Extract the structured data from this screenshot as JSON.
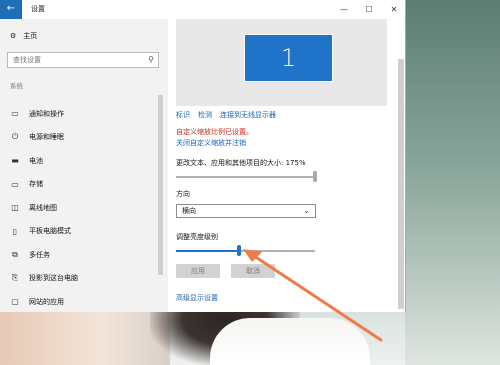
{
  "window": {
    "title": "设置",
    "back": "←",
    "minimize": "—",
    "maximize": "☐",
    "close": "✕"
  },
  "sidebar": {
    "home": "主页",
    "search_placeholder": "查找设置",
    "section": "系统",
    "items": [
      {
        "label": "通知和操作",
        "icon": "notification-icon"
      },
      {
        "label": "电源和睡眠",
        "icon": "power-icon"
      },
      {
        "label": "电池",
        "icon": "battery-icon"
      },
      {
        "label": "存储",
        "icon": "storage-icon"
      },
      {
        "label": "离线地图",
        "icon": "map-icon"
      },
      {
        "label": "平板电脑模式",
        "icon": "tablet-icon"
      },
      {
        "label": "多任务",
        "icon": "multitask-icon"
      },
      {
        "label": "投影到这台电脑",
        "icon": "project-icon"
      },
      {
        "label": "网站的应用",
        "icon": "web-apps-icon"
      }
    ]
  },
  "display": {
    "monitor_number": "1",
    "links": {
      "identify": "标识",
      "detect": "检测",
      "wireless": "连接到无线显示器"
    },
    "warning": "自定义缩放比例已设置。",
    "turn_off": "关闭自定义缩放并注销",
    "scale_label": "更改文本、应用和其他项目的大小: 175%",
    "scale_fraction": 1.0,
    "orientation_label": "方向",
    "orientation_value": "横向",
    "brightness_label": "调整亮度级别",
    "brightness_fraction": 0.45,
    "apply": "应用",
    "cancel": "取消",
    "advanced": "高级显示设置"
  },
  "colors": {
    "accent": "#1f74c9",
    "warning": "#d0231b",
    "arrow": "#f07a4a"
  }
}
